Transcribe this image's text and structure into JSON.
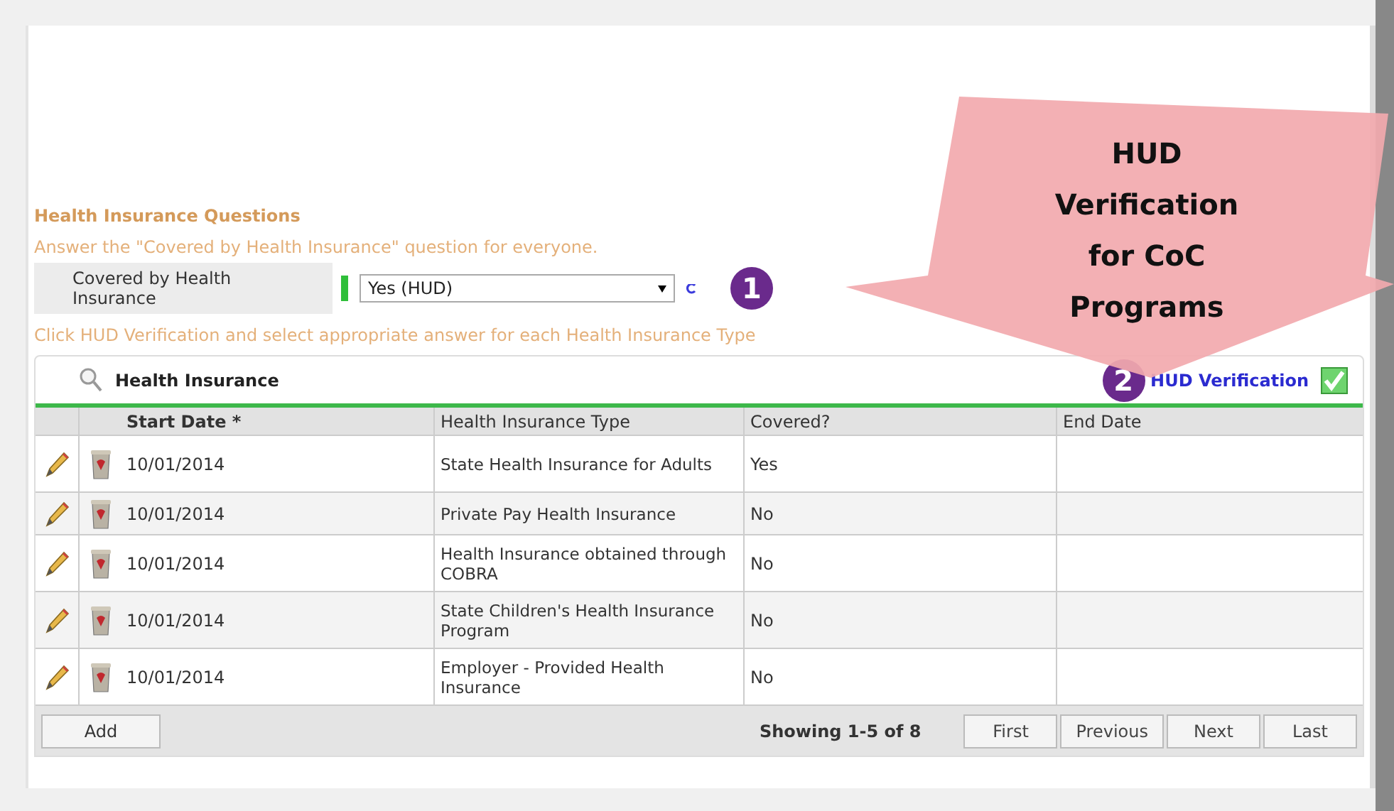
{
  "section": {
    "title": "Health Insurance Questions",
    "instruction": "Answer the \"Covered by Health Insurance\" question for everyone.",
    "question": {
      "label": "Covered by Health Insurance",
      "value": "Yes (HUD)",
      "required": true
    },
    "step_one": "1",
    "instruction_2": "Click HUD Verification and select appropriate answer for each Health Insurance Type"
  },
  "callout": {
    "text": "HUD Verification for CoC Programs"
  },
  "table": {
    "title": "Health Insurance",
    "step_two": "2",
    "verification_link": "HUD Verification",
    "verified": true,
    "columns": [
      "Start Date *",
      "Health Insurance Type",
      "Covered?",
      "End Date"
    ],
    "rows": [
      {
        "start_date": "10/01/2014",
        "type": "State Health Insurance for Adults",
        "covered": "Yes"
      },
      {
        "start_date": "10/01/2014",
        "type": "Private Pay Health Insurance",
        "covered": "No"
      },
      {
        "start_date": "10/01/2014",
        "type": "Health Insurance obtained through COBRA",
        "covered": "No"
      },
      {
        "start_date": "10/01/2014",
        "type": "State Children's Health Insurance Program",
        "covered": "No"
      },
      {
        "start_date": "10/01/2014",
        "type": "Employer - Provided Health Insurance",
        "covered": "No"
      }
    ],
    "add_button": "Add",
    "paging_text": "Showing 1-5 of 8",
    "pager": [
      "First",
      "Previous",
      "Next",
      "Last"
    ]
  }
}
